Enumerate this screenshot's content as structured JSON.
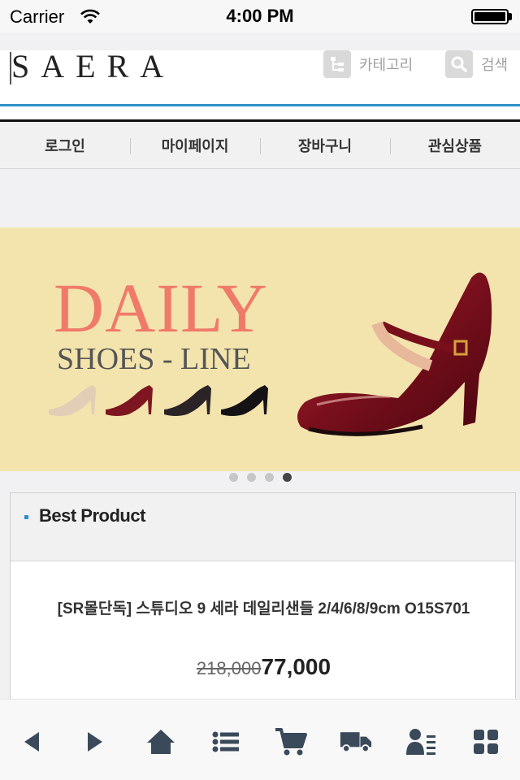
{
  "status_bar": {
    "carrier": "Carrier",
    "time": "4:00 PM"
  },
  "header": {
    "logo": "SAERA",
    "category_label": "카테고리",
    "search_label": "검색",
    "accent_color": "#2f8fc7"
  },
  "nav": {
    "items": [
      {
        "label": "로그인"
      },
      {
        "label": "마이페이지"
      },
      {
        "label": "장바구니"
      },
      {
        "label": "관심상품"
      }
    ]
  },
  "banner": {
    "title": "DAILY",
    "subtitle": "SHOES - LINE",
    "title_color": "#f07a6a",
    "background": "#f3e4ad",
    "slides": 4,
    "active_slide": 4
  },
  "best_product": {
    "section_title": "Best Product",
    "product_name": "[SR몰단독] 스튜디오 9 세라 데일리샌들 2/4/6/8/9cm O15S701",
    "original_price": "218,000",
    "sale_price": "77,000"
  },
  "toolbar": {
    "icons": [
      "back-arrow-icon",
      "forward-arrow-icon",
      "home-icon",
      "list-icon",
      "cart-icon",
      "delivery-truck-icon",
      "my-account-icon",
      "grid-menu-icon"
    ]
  }
}
